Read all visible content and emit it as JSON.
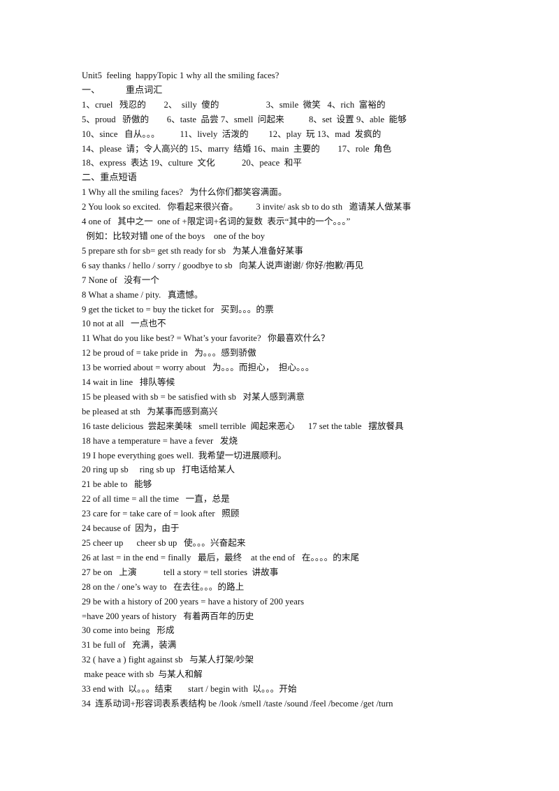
{
  "document": {
    "title": "Unit5  feeling  happyTopic 1 why all the smiling faces?",
    "section_one_heading": "一、           重点词汇",
    "section_two_heading": "二、重点短语",
    "vocab_lines": [
      "1、cruel   残忍的        2、  silly  傻的                     3、smile  微笑   4、rich  富裕的",
      "5、proud   骄傲的        6、taste  品尝 7、smell  问起来           8、set  设置 9、able  能够",
      "10、since   自从。。。         11、lively  活泼的         12、play  玩 13、mad  发疯的",
      "14、please  请；令人高兴的 15、marry  结婚 16、main  主要的        17、role  角色",
      "18、express  表达 19、culture  文化            20、peace  和平"
    ],
    "phrase_lines": [
      "1 Why all the smiling faces?   为什么你们都笑容满面。",
      "2 You look so excited.   你看起来很兴奋。        3 invite/ ask sb to do sth   邀请某人做某事",
      "4 one of   其中之一  one of +限定词+名词的复数  表示“其中的一个。。。”",
      "  例如：比较对错 one of the boys    one of the boy",
      "5 prepare sth for sb= get sth ready for sb   为某人准备好某事",
      "6 say thanks / hello / sorry / goodbye to sb   向某人说声谢谢/ 你好/抱歉/再见",
      "7 None of   没有一个",
      "8 What a shame / pity.   真遗憾。",
      "9 get the ticket to = buy the ticket for   买到。。。的票",
      "10 not at all   一点也不",
      "11 What do you like best? = What’s your favorite?   你最喜欢什么？",
      "12 be proud of = take pride in   为。。。感到骄傲",
      "13 be worried about = worry about   为。。。而担心，  担心。。。",
      "14 wait in line   排队等候",
      "15 be pleased with sb = be satisfied with sb   对某人感到满意",
      "be pleased at sth   为某事而感到高兴",
      "16 taste delicious  尝起来美味   smell terrible  闻起来恶心      17 set the table   摆放餐具",
      "18 have a temperature = have a fever   发烧",
      "19 I hope everything goes well.  我希望一切进展顺利。",
      "20 ring up sb     ring sb up   打电话给某人",
      "21 be able to   能够",
      "22 of all time = all the time   一直，总是",
      "23 care for = take care of = look after   照顾",
      "24 because of  因为，由于",
      "25 cheer up      cheer sb up   使。。。兴奋起来",
      "26 at last = in the end = finally   最后，最终    at the end of   在。。。。的末尾",
      "27 be on   上演            tell a story = tell stories  讲故事",
      "28 on the / one’s way to   在去往。。。的路上",
      "29 be with a history of 200 years = have a history of 200 years",
      "=have 200 years of history   有着两百年的历史",
      "30 come into being   形成",
      "31 be full of   充满，装满",
      "32 ( have a ) fight against sb   与某人打架/吵架",
      " make peace with sb  与某人和解",
      "33 end with  以。。。结束       start / begin with  以。。。开始",
      "34  连系动词+形容词表系表结构 be /look /smell /taste /sound /feel /become /get /turn"
    ]
  }
}
